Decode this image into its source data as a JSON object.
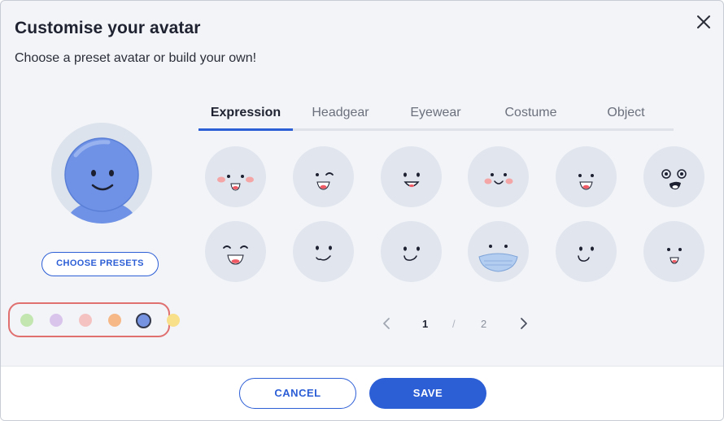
{
  "dialog": {
    "title": "Customise your avatar",
    "subtitle": "Choose a preset avatar or build your own!",
    "close_icon": "close-icon"
  },
  "avatar": {
    "body_color": "#6f92e6",
    "face": "smile"
  },
  "presets_button": "CHOOSE PRESETS",
  "colors": {
    "swatches": [
      "#c3e6b0",
      "#d9c4ec",
      "#f5c2c2",
      "#f6b887",
      "#7593e0",
      "#f8df8a"
    ],
    "selected_index": 4,
    "highlight_color": "#e07070"
  },
  "tabs": [
    {
      "label": "Expression",
      "active": true
    },
    {
      "label": "Headgear",
      "active": false
    },
    {
      "label": "Eyewear",
      "active": false
    },
    {
      "label": "Costume",
      "active": false
    },
    {
      "label": "Object",
      "active": false
    }
  ],
  "expressions": [
    "blushing-smile",
    "wink",
    "grin",
    "blushing-smile-small",
    "happy",
    "dizzy",
    "laughing",
    "smirk",
    "half-smile",
    "masked",
    "content",
    "simple-smile"
  ],
  "pagination": {
    "current": "1",
    "separator": "/",
    "total": "2",
    "prev_icon": "chevron-left-icon",
    "next_icon": "chevron-right-icon"
  },
  "footer": {
    "cancel_label": "CANCEL",
    "save_label": "SAVE"
  },
  "theme": {
    "accent": "#2c5ed6",
    "face_bg": "#e1e6ee",
    "panel_bg": "#f2f4f8"
  }
}
